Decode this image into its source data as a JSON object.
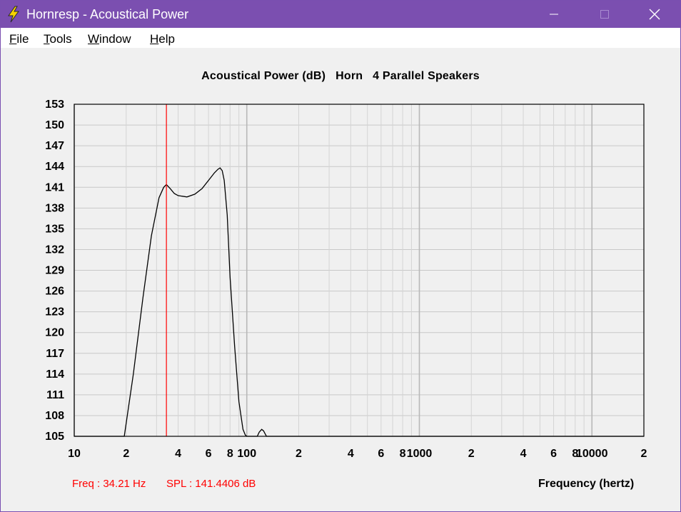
{
  "window": {
    "title": "Hornresp - Acoustical Power"
  },
  "icons": {
    "app": "lightning-bolt-icon",
    "minimize": "minimize-icon",
    "maximize": "maximize-icon",
    "close": "close-icon"
  },
  "menu": {
    "items": [
      {
        "label": "File",
        "underline": "F",
        "rest": "ile"
      },
      {
        "label": "Tools",
        "underline": "T",
        "rest": "ools"
      },
      {
        "label": "Window",
        "underline": "W",
        "rest": "indow"
      },
      {
        "label": "Help",
        "underline": "H",
        "rest": "elp"
      }
    ]
  },
  "colors": {
    "titlebar": "#7b4fb0",
    "cursor": "#ff0000",
    "grid": "#c8c8c8",
    "curve": "#000000"
  },
  "readout": {
    "freq": "Freq : 34.21 Hz",
    "spl": "SPL : 141.4406 dB"
  },
  "chart_data": {
    "type": "line",
    "title": "Acoustical Power (dB)   Horn   4 Parallel Speakers",
    "xlabel": "Frequency (hertz)",
    "ylabel": "",
    "x_scale": "log",
    "xlim": [
      10,
      20000
    ],
    "ylim": [
      105,
      153
    ],
    "grid": true,
    "yticks": [
      "153",
      "150",
      "147",
      "144",
      "141",
      "138",
      "135",
      "132",
      "129",
      "126",
      "123",
      "120",
      "117",
      "114",
      "111",
      "108",
      "105"
    ],
    "xticks": [
      {
        "v": 10,
        "t": "10"
      },
      {
        "v": 20,
        "t": "2"
      },
      {
        "v": 40,
        "t": "4"
      },
      {
        "v": 60,
        "t": "6"
      },
      {
        "v": 80,
        "t": "8"
      },
      {
        "v": 100,
        "t": "100"
      },
      {
        "v": 200,
        "t": "2"
      },
      {
        "v": 400,
        "t": "4"
      },
      {
        "v": 600,
        "t": "6"
      },
      {
        "v": 800,
        "t": "8"
      },
      {
        "v": 1000,
        "t": "1000"
      },
      {
        "v": 2000,
        "t": "2"
      },
      {
        "v": 4000,
        "t": "4"
      },
      {
        "v": 6000,
        "t": "6"
      },
      {
        "v": 8000,
        "t": "8"
      },
      {
        "v": 10000,
        "t": "10000"
      },
      {
        "v": 20000,
        "t": "2"
      }
    ],
    "cursor_x": 34.21,
    "series": [
      {
        "x": [
          10,
          19.5,
          22,
          25,
          28,
          31,
          33,
          34.21,
          36,
          38,
          40,
          45,
          50,
          55,
          60,
          65,
          68,
          70,
          72,
          74,
          77,
          80,
          85,
          90,
          95,
          98,
          100,
          115,
          118,
          122,
          125,
          128,
          130,
          132,
          20000
        ],
        "y": [
          105,
          105,
          114,
          125,
          134,
          139.5,
          141,
          141.4,
          140.8,
          140.1,
          139.8,
          139.6,
          140.0,
          140.8,
          142.0,
          143.1,
          143.6,
          143.8,
          143.4,
          142.0,
          137.0,
          128.0,
          118.0,
          110.0,
          106.0,
          105.2,
          105,
          105,
          105.6,
          106.0,
          105.8,
          105.3,
          105,
          105,
          105
        ]
      }
    ]
  }
}
